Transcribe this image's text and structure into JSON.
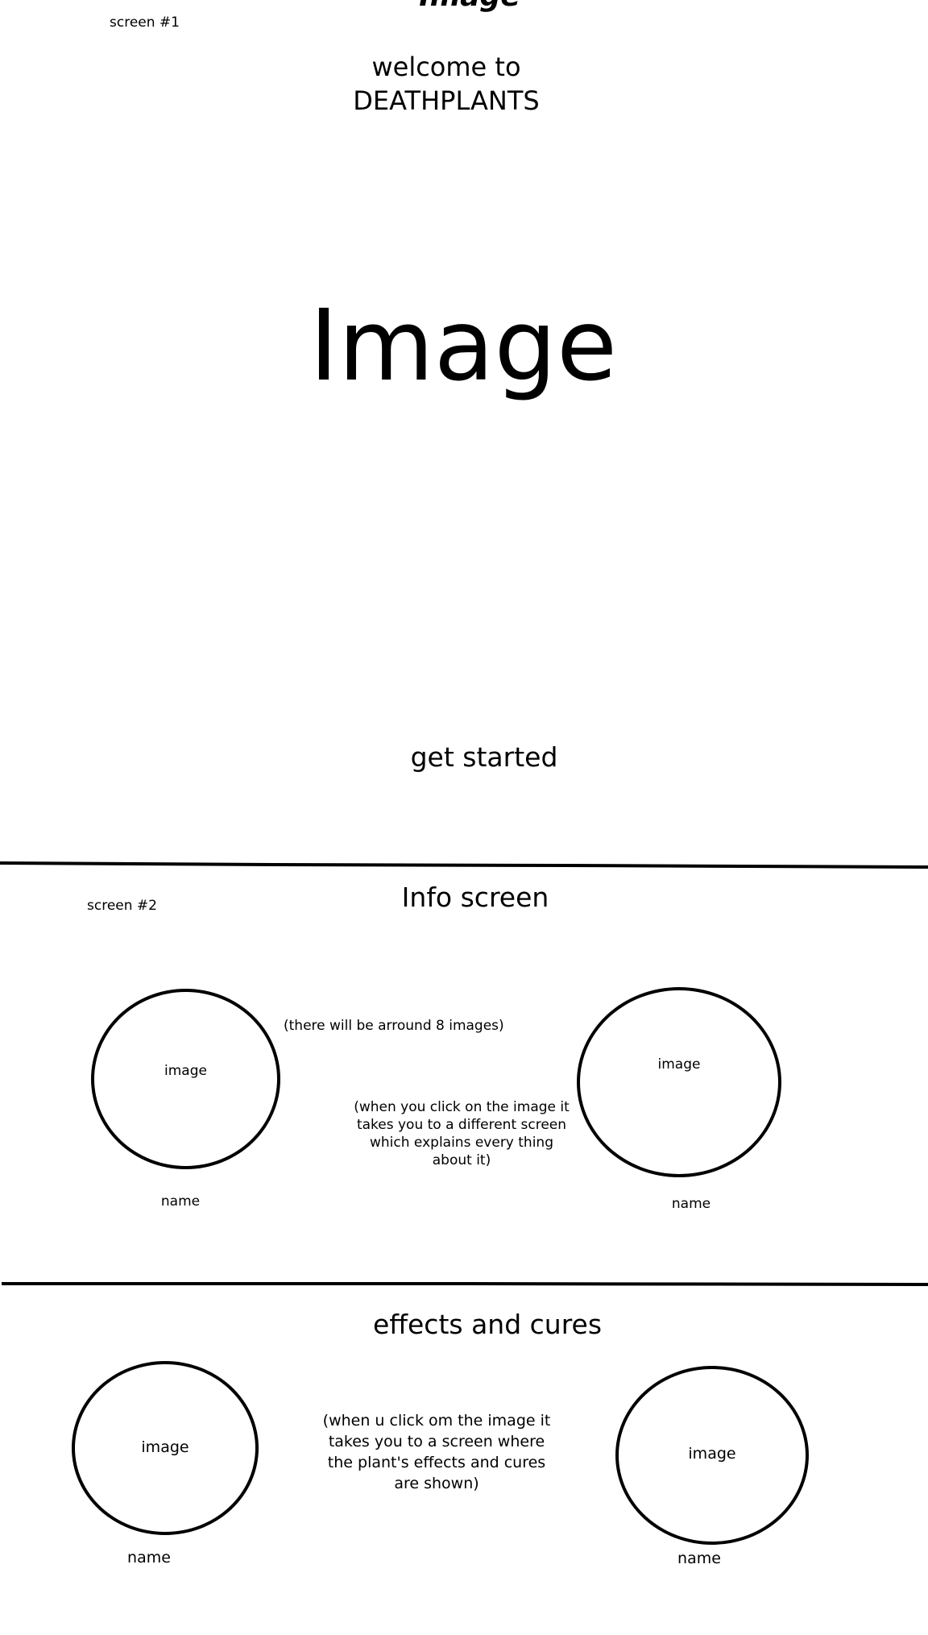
{
  "top_cutoff_text": "Image",
  "screen1": {
    "label": "screen #1",
    "welcome_line1": "welcome to",
    "welcome_line2": "DEATHPLANTS",
    "hero_image_text": "Image",
    "button_label": "get started"
  },
  "screen2": {
    "label": "screen #2",
    "title": "Info screen",
    "images_note": "(there will be arround 8 images)",
    "click_note": "(when you click on the image it takes you to a different screen which explains every thing about it)",
    "left_card": {
      "image_text": "image",
      "name": "name"
    },
    "right_card": {
      "image_text": "image",
      "name": "name"
    }
  },
  "screen3": {
    "title": "effects and cures",
    "note": "(when u click om the image it takes you to a screen where the plant's effects and cures are shown)",
    "left_card": {
      "image_text": "image",
      "name": "name"
    },
    "right_card": {
      "image_text": "image",
      "name": "name"
    }
  }
}
